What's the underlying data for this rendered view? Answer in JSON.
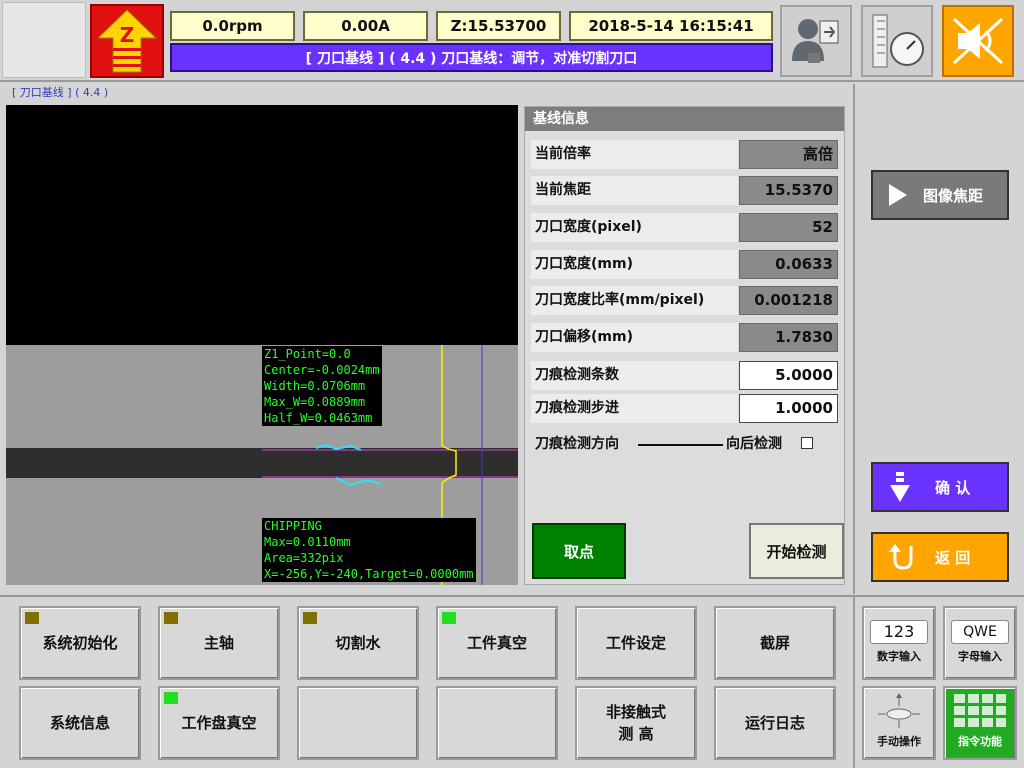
{
  "status": {
    "rpm": "0.0rpm",
    "current": "0.00A",
    "z": "Z:15.53700",
    "datetime": "2018-5-14 16:15:41"
  },
  "title": "[ 刀口基线 ] ( 4.4 )  刀口基线：调节，对准切割刀口",
  "zbutton": {
    "label": "Z"
  },
  "breadcrumb": "[ 刀口基线 ] ( 4.4 )",
  "overlay": {
    "top": [
      "Z1_Point=0.0",
      "Center=-0.0024mm",
      "Width=0.0706mm",
      "Max_W=0.0889mm",
      "Half_W=0.0463mm"
    ],
    "bottom": [
      "CHIPPING",
      "Max=0.0110mm",
      "Area=332pix",
      "X=-256,Y=-240,Target=0.0000mm"
    ]
  },
  "info": {
    "title": "基线信息",
    "rows": [
      {
        "label": "当前倍率",
        "value": "高倍",
        "editable": false
      },
      {
        "label": "当前焦距",
        "value": "15.5370",
        "editable": false
      },
      {
        "label": "刀口宽度(pixel)",
        "value": "52",
        "editable": false
      },
      {
        "label": "刀口宽度(mm)",
        "value": "0.0633",
        "editable": false
      },
      {
        "label": "刀口宽度比率(mm/pixel)",
        "value": "0.001218",
        "editable": false
      },
      {
        "label": "刀口偏移(mm)",
        "value": "1.7830",
        "editable": false
      },
      {
        "label": "刀痕检测条数",
        "value": "5.0000",
        "editable": true
      },
      {
        "label": "刀痕检测步进",
        "value": "1.0000",
        "editable": true
      }
    ],
    "direction_label": "刀痕检测方向",
    "direction_value": "向后检测",
    "take_point": "取点",
    "start_detect": "开始检测"
  },
  "right": {
    "focus": "图像焦距",
    "confirm": "确 认",
    "back": "返 回"
  },
  "functions": [
    {
      "label": "系统初始化",
      "indicator": "#807000"
    },
    {
      "label": "主轴",
      "indicator": "#807000"
    },
    {
      "label": "切割水",
      "indicator": "#807000"
    },
    {
      "label": "工件真空",
      "indicator": "#22dd22"
    },
    {
      "label": "工件设定",
      "indicator": ""
    },
    {
      "label": "截屏",
      "indicator": ""
    },
    {
      "label": "系统信息",
      "indicator": ""
    },
    {
      "label": "工作盘真空",
      "indicator": "#22dd22"
    },
    {
      "label": "",
      "indicator": ""
    },
    {
      "label": "",
      "indicator": ""
    },
    {
      "label": "非接触式\n测  高",
      "indicator": ""
    },
    {
      "label": "运行日志",
      "indicator": ""
    }
  ],
  "side_buttons": {
    "num_input": "数字输入",
    "num_icon": "123",
    "char_input": "字母输入",
    "char_icon": "QWE",
    "manual": "手动操作",
    "command": "指令功能"
  },
  "colors": {
    "accent": "#6a32ff",
    "title_bar": "#6a32ff",
    "status_bg": "#ffffcc",
    "confirm": "#6a32ff",
    "back": "#ffa500",
    "take_point": "#008000",
    "command": "#22aa22"
  }
}
